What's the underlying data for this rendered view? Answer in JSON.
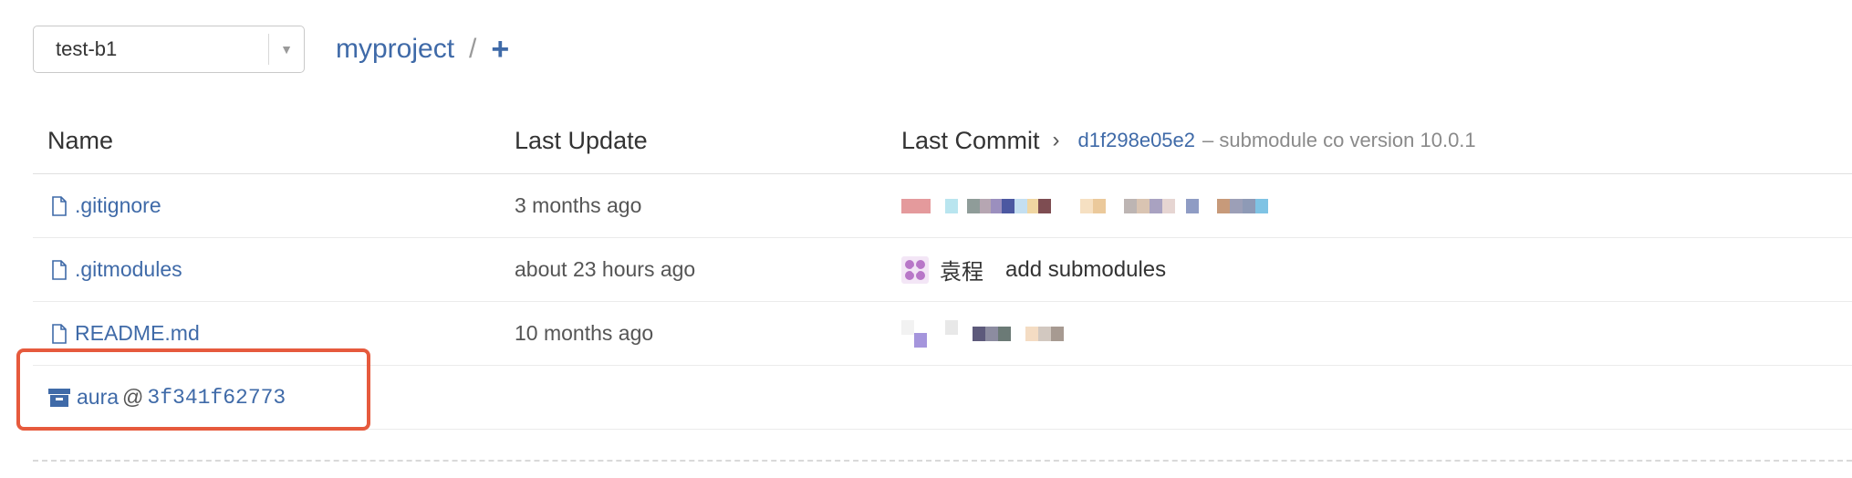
{
  "branch_selector": {
    "value": "test-b1"
  },
  "breadcrumb": {
    "repo": "myproject",
    "separator": "/",
    "add": "+"
  },
  "table": {
    "headers": {
      "name": "Name",
      "last_update": "Last Update",
      "last_commit": "Last Commit"
    },
    "last_commit": {
      "sha": "d1f298e05e2",
      "message": "– submodule co version 10.0.1"
    },
    "rows": [
      {
        "name": ".gitignore",
        "type": "file",
        "date": "3 months ago",
        "commit_author": "",
        "commit_message": ""
      },
      {
        "name": ".gitmodules",
        "type": "file",
        "date": "about 23 hours ago",
        "commit_author": "袁程",
        "commit_message": "add submodules"
      },
      {
        "name": "README.md",
        "type": "file",
        "date": "10 months ago",
        "commit_author": "",
        "commit_message": ""
      },
      {
        "name": "aura",
        "type": "submodule",
        "at": "@",
        "sha": "3f341f62773",
        "date": "",
        "commit_message": ""
      }
    ]
  },
  "colors": {
    "link": "#3f6aa8",
    "highlight": "#e65a3d"
  },
  "icons": {
    "file": "file-icon",
    "submodule": "archive-box-icon",
    "chevron": "chevron-right-icon",
    "caret": "caret-down-icon"
  }
}
